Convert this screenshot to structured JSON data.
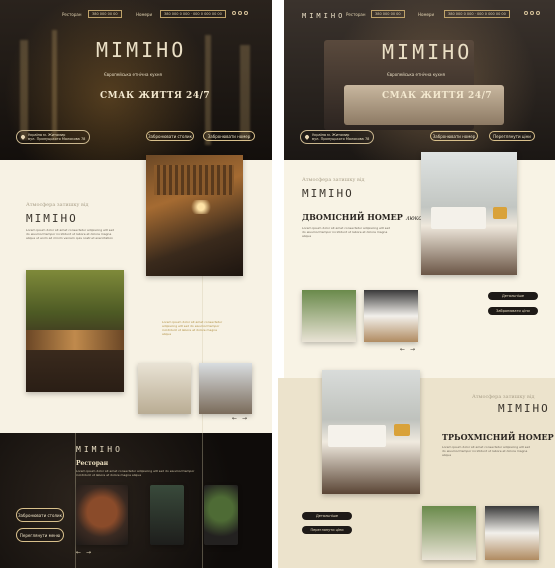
{
  "brand": {
    "logo": "MIMIHO"
  },
  "nav": {
    "item_restaurant": "Ресторан",
    "item_rooms": "Номери",
    "phone_1": "380 000 00 00",
    "phone_2": "380 000 0 000 · 000 0 000 00 00"
  },
  "hero_left": {
    "subtitle": "Європейська етнічна кухня",
    "tagline": "СМАК ЖИТТЯ 24/7",
    "address_line1": "Україна м. Житомир",
    "address_line2": "вул. Прилуцького Молокова 78",
    "btn_table": "Забронювати столик",
    "btn_room": "Забронювати номер"
  },
  "hero_right": {
    "subtitle": "Європейська етнічна кухня",
    "tagline": "СМАК ЖИТТЯ 24/7",
    "address_line1": "Україна м. Житомир",
    "address_line2": "вул. Прилуцького Молокова 78",
    "btn_room": "Забронювати номер",
    "btn_tour": "Переглянути ціни"
  },
  "about": {
    "label": "Атмосфера затишку від",
    "logo": "MIMIHO",
    "text": "Lorem ipsum dolor sit amet consectetur adipiscing elit sed do eiusmod tempor incididunt ut labore et dolore magna aliqua ut enim ad minim veniam quis nostrud exercitation",
    "gold_text": "Lorem ipsum dolor sit amet consectetur adipiscing elit sed do eiusmod tempor incididunt ut labore et dolore magna aliqua"
  },
  "restaurant": {
    "logo": "MIMIHO",
    "title": "Ресторан",
    "text": "Lorem ipsum dolor sit amet consectetur adipiscing elit sed do eiusmod tempor incididunt ut labore et dolore magna aliqua",
    "btn_table": "Забронювати столик",
    "btn_menu": "Переглянути меню"
  },
  "room_double": {
    "label": "Атмосфера затишку від",
    "logo": "MIMIHO",
    "title": "ДВОМІСНИЙ НОМЕР",
    "title_suffix": "люкс",
    "text": "Lorem ipsum dolor sit amet consectetur adipiscing elit sed do eiusmod tempor incididunt ut labore et dolore magna aliqua",
    "btn_details": "Детальніше",
    "btn_book": "Забронювати ціни"
  },
  "room_triple": {
    "label": "Атмосфера затишку від",
    "logo": "MIMIHO",
    "title": "ТРЬОХМІСНИЙ НОМЕР",
    "text": "Lorem ipsum dolor sit amet consectetur adipiscing elit sed do eiusmod tempor incididunt ut labore et dolore magna aliqua",
    "btn_details": "Детальніше",
    "btn_book": "Переглянути ціни"
  },
  "arrows": {
    "prev": "←",
    "next": "→"
  }
}
